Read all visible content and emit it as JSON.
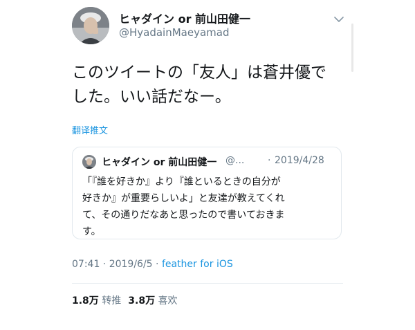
{
  "author": {
    "display_name": "ヒャダイン or 前山田健一",
    "handle": "@HyadainMaeyamad",
    "avatar_icon": "profile-photo"
  },
  "tweet": {
    "text_lines": [
      "このツイートの「友人」は蒼井優で",
      "した。いい話だなー。"
    ],
    "translate_label": "翻译推文",
    "timestamp": "07:41 · 2019/6/5",
    "separator": " · ",
    "source": "feather for iOS",
    "menu_icon": "chevron-down-icon"
  },
  "quoted": {
    "display_name": "ヒャダイン or 前山田健一",
    "handle": "@...",
    "dot": "·",
    "date": "2019/4/28",
    "text_lines": [
      "「『誰を好きか』より『誰といるときの自分が",
      "好きか』が重要らしいよ」と友達が教えてくれ",
      "て、その通りだなあと思ったので書いておきま",
      "す。"
    ]
  },
  "stats": {
    "retweets_count": "1.8万",
    "retweets_label": "转推",
    "likes_count": "3.8万",
    "likes_label": "喜欢"
  },
  "colors": {
    "link": "#1b95e0",
    "secondary_text": "#657786",
    "primary_text": "#14171a",
    "border": "#e1e8ed"
  }
}
